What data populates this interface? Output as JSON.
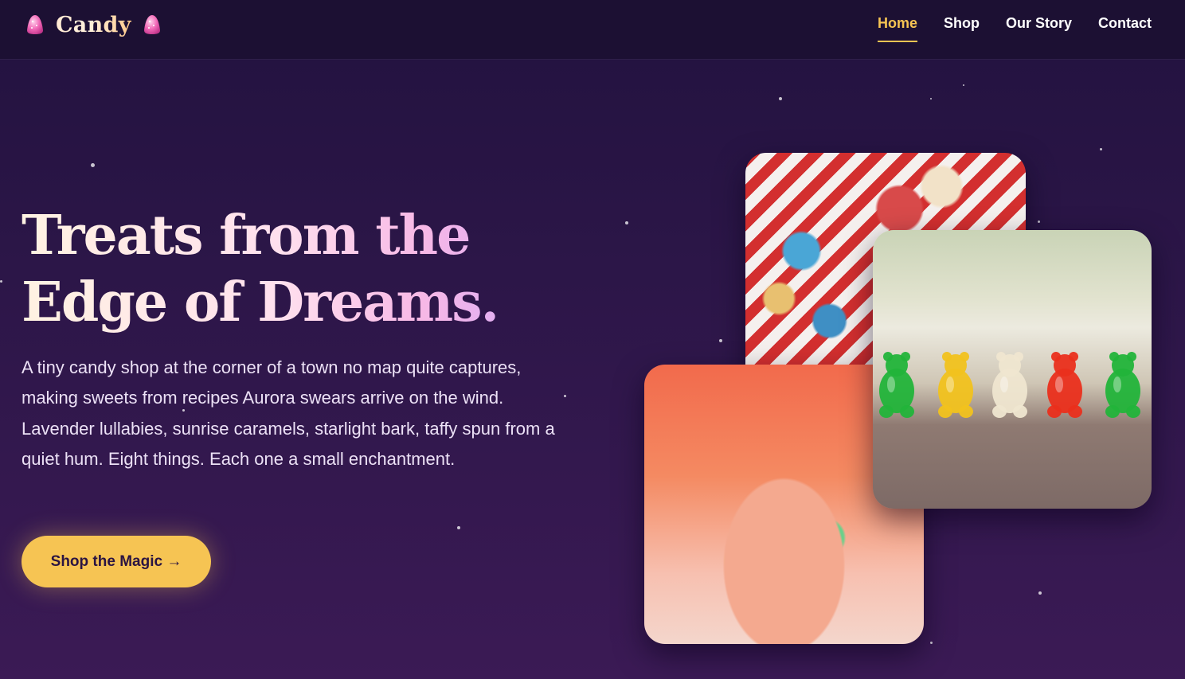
{
  "brand": {
    "name": "Candy",
    "icon": "gumdrop-icon",
    "accent_color": "#f6c453"
  },
  "nav": {
    "items": [
      {
        "label": "Home",
        "active": true
      },
      {
        "label": "Shop",
        "active": false
      },
      {
        "label": "Our Story",
        "active": false
      },
      {
        "label": "Contact",
        "active": false
      }
    ]
  },
  "hero": {
    "headline_line1": "Treats from the",
    "headline_line2": "Edge of Dreams.",
    "intro": "A tiny candy shop at the corner of a town no map quite captures, making sweets from recipes Aurora swears arrive on the wind. Lavender lullabies, sunrise caramels, starlight bark, taffy spun from a quiet hum. Eight things. Each one a small enchantment.",
    "cta_label": "Shop the Magic →"
  },
  "gallery": {
    "photos": [
      {
        "subject": "cupcakes-photo"
      },
      {
        "subject": "gummy-bears-photo"
      },
      {
        "subject": "saltwater-taffy-photo"
      }
    ],
    "gummy_bear_colors": [
      "#22b43a",
      "#f1c21d",
      "#efe6d0",
      "#ea2f1c",
      "#22b43a"
    ]
  },
  "colors": {
    "background": "#2c1648",
    "header": "#1c1033",
    "button": "#f6c453"
  }
}
